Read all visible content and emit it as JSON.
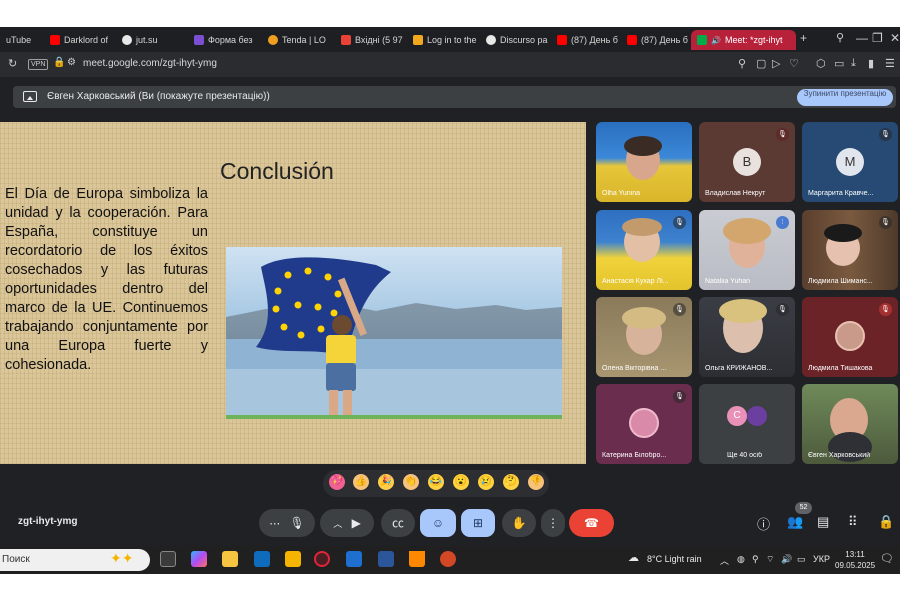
{
  "browser": {
    "tabs": [
      {
        "label": "uTube",
        "color": "#ff0000"
      },
      {
        "label": "Darklord of",
        "color": "#ff0000"
      },
      {
        "label": "jut.su",
        "color": "#e8e8e8"
      },
      {
        "label": "Форма без",
        "color": "#7b4fd4"
      },
      {
        "label": "Tenda | LO",
        "color": "#f0a020"
      },
      {
        "label": "Вхідні (5 97",
        "color": "#ea4335"
      },
      {
        "label": "Log in to the",
        "color": "#f3a820"
      },
      {
        "label": "Discurso pa",
        "color": "#e8e8e8"
      },
      {
        "label": "(87) День б",
        "color": "#ff0000"
      },
      {
        "label": "(87) День б",
        "color": "#ff0000"
      }
    ],
    "active_tab": {
      "label": "Meet: *zgt-ihyt",
      "accent": "#b8213a"
    },
    "new_tab_label": "+",
    "vpn_label": "VPN",
    "url": "meet.google.com/zgt-ihyt-ymg"
  },
  "meet": {
    "presenter_bar": {
      "text": "Євген Харковський (Ви (покажуте презентацію))",
      "stop_button": "Зупинити презентацію"
    },
    "slide": {
      "title": "Conclusión",
      "body": "El Día de Europa simboliza la unidad y la cooperación. Para España, constituye un recordatorio de los éxitos cosechados y las futuras oportunidades dentro del marco de la UE. Continuemos trabajando conjuntamente por una Europa fuerte y cohesionada."
    },
    "participants": [
      {
        "name": "Olha Yunina",
        "muted": false
      },
      {
        "name": "Владислав Некрут",
        "muted": true,
        "initial": "В",
        "avatar_color": "#8d6e63"
      },
      {
        "name": "Маргарита Кравче...",
        "muted": true,
        "initial": "М",
        "avatar_color": "#5f6f8f"
      },
      {
        "name": "Анастасія Кухар Лі...",
        "muted": true
      },
      {
        "name": "Nataliia Yuhan",
        "muted": false
      },
      {
        "name": "Людмила Шиманс...",
        "muted": true
      },
      {
        "name": "Олена Вікторівна ...",
        "muted": true
      },
      {
        "name": "Ольга КРИЖАНОВ...",
        "muted": true
      },
      {
        "name": "Людмила Тишакова",
        "muted": true
      },
      {
        "name": "Катерина Білобро...",
        "muted": true
      },
      {
        "name": "Ще 40 осіб",
        "muted": false,
        "initial": "С",
        "avatar_color": "#e991b8"
      },
      {
        "name": "Євген Харковський",
        "muted": false
      }
    ],
    "reactions": [
      "💖",
      "👍",
      "🎉",
      "👏",
      "😂",
      "😮",
      "😢",
      "🤔",
      "👎"
    ],
    "meeting_code": "zgt-ihyt-ymg",
    "people_count": "52"
  },
  "taskbar": {
    "search_placeholder": "Поиск",
    "weather": "8°C  Light rain",
    "language": "УКР",
    "time": "13:11",
    "date": "09.05.2025"
  }
}
